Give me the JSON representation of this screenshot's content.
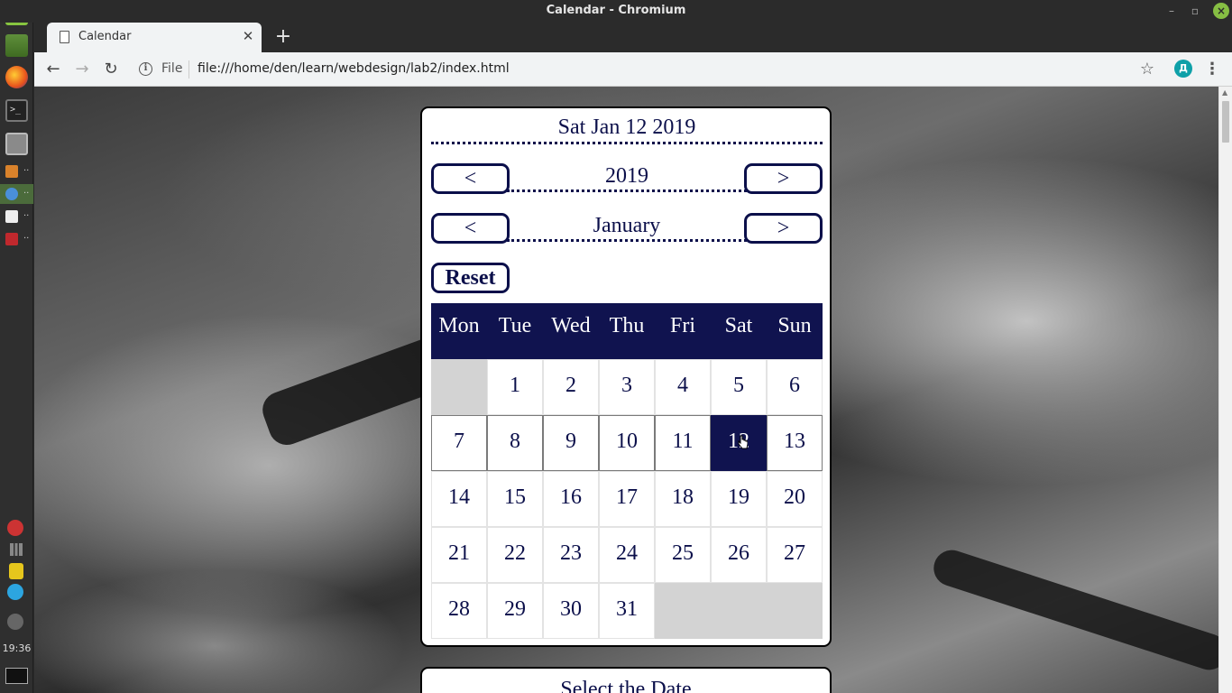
{
  "taskbar": {
    "mint_label": "m",
    "terminal_label": ">_",
    "clock": "19:36",
    "window_dots": ".."
  },
  "window": {
    "title": "Calendar - Chromium"
  },
  "tabs": [
    {
      "title": "Calendar"
    }
  ],
  "toolbar": {
    "scheme_label": "File",
    "url": "file:///home/den/learn/webdesign/lab2/index.html",
    "profile_initial": "Д"
  },
  "calendar": {
    "current_date": "Sat Jan 12 2019",
    "year": "2019",
    "month": "January",
    "prev_label": "<",
    "next_label": ">",
    "reset_label": "Reset",
    "weekdays": [
      "Mon",
      "Tue",
      "Wed",
      "Thu",
      "Fri",
      "Sat",
      "Sun"
    ],
    "selected_day": "12",
    "weeks": [
      [
        "",
        "1",
        "2",
        "3",
        "4",
        "5",
        "6"
      ],
      [
        "7",
        "8",
        "9",
        "10",
        "11",
        "12",
        "13"
      ],
      [
        "14",
        "15",
        "16",
        "17",
        "18",
        "19",
        "20"
      ],
      [
        "21",
        "22",
        "23",
        "24",
        "25",
        "26",
        "27"
      ],
      [
        "28",
        "29",
        "30",
        "31",
        "",
        "",
        ""
      ]
    ]
  },
  "second_card": {
    "title": "Select the Date"
  },
  "colors": {
    "accent_navy": "#10134f",
    "text_navy": "#0b0f4a",
    "empty_cell": "#d3d3d3",
    "mint_green": "#87c540"
  }
}
